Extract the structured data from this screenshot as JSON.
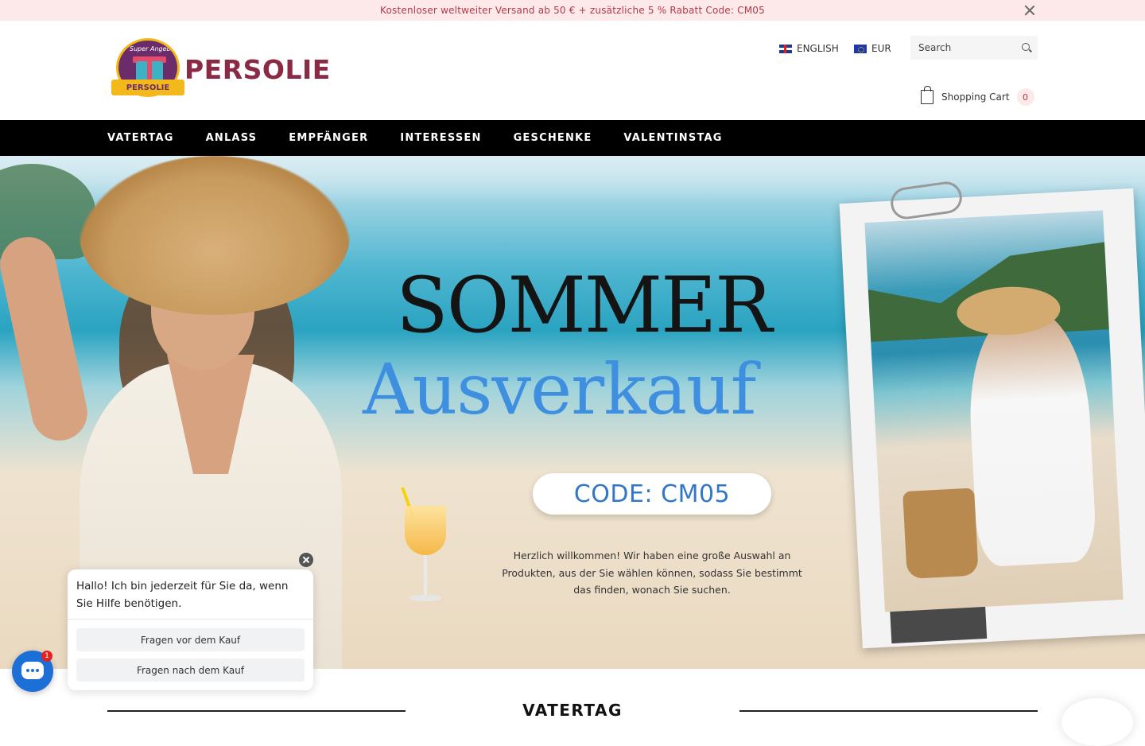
{
  "announcement": {
    "text": "Kostenloser weltweiter Versand ab 50 € + zusätzliche 5 % Rabatt Code: CM05"
  },
  "logo": {
    "badge_text": "Super Angebot",
    "ribbon_text": "PERSOLIE",
    "wordmark": "PERSOLIE"
  },
  "header": {
    "language": "ENGLISH",
    "currency": "EUR",
    "search_placeholder": "Search",
    "cart_label": "Shopping Cart",
    "cart_count": "0"
  },
  "nav": {
    "items": [
      "VATERTAG",
      "ANLASS",
      "EMPFÄNGER",
      "INTERESSEN",
      "GESCHENKE",
      "VALENTINSTAG"
    ]
  },
  "hero": {
    "headline_1": "SOMMER",
    "headline_2": "Ausverkauf",
    "code": "CODE: CM05",
    "description": "Herzlich willkommen! Wir haben eine große Auswahl an Produkten, aus der Sie wählen können, sodass Sie bestimmt das finden, wonach Sie suchen."
  },
  "chat": {
    "message": "Hallo! Ich bin jederzeit für Sie da, wenn Sie Hilfe benötigen.",
    "options": [
      "Fragen vor dem Kauf",
      "Fragen nach dem Kauf"
    ],
    "badge_count": "1"
  },
  "section": {
    "title": "VATERTAG"
  },
  "colors": {
    "announcement_bg": "#fde8ea",
    "announcement_text": "#b23a48",
    "nav_bg": "#000000",
    "brand": "#8a2a45",
    "headline_accent": "#3e8fe0",
    "chat_launcher": "#1d6fd8"
  },
  "icons": [
    "close-icon",
    "uk-flag-icon",
    "eu-flag-icon",
    "search-icon",
    "shopping-bag-icon",
    "chat-icon"
  ]
}
